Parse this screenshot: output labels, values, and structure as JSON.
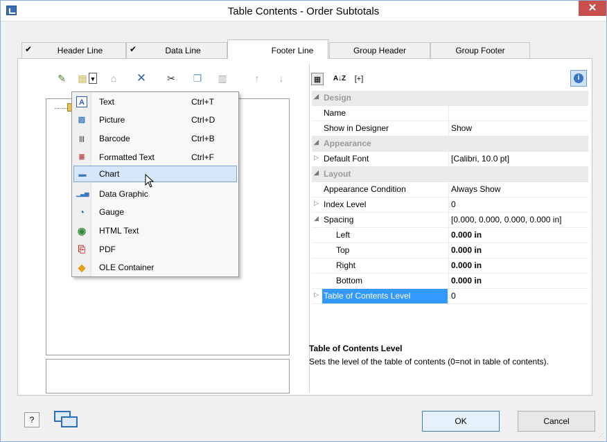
{
  "window": {
    "title": "Table Contents - Order Subtotals",
    "close_glyph": "✕"
  },
  "tabs": [
    {
      "label": "Header Line",
      "checked": true
    },
    {
      "label": "Data Line",
      "checked": true
    },
    {
      "label": "Footer Line",
      "checked": false,
      "active": true
    },
    {
      "label": "Group Header",
      "checked": false
    },
    {
      "label": "Group Footer",
      "checked": false
    }
  ],
  "check_glyph": "✔",
  "left_toolbar": {
    "icons": [
      "edit-object-icon",
      "insert-object-icon",
      "dropdown-arrow-icon",
      "properties-icon",
      "delete-icon",
      "cut-icon",
      "copy-icon",
      "paste-icon",
      "move-up-icon",
      "move-down-icon"
    ]
  },
  "insert_menu": {
    "items": [
      {
        "label": "Text",
        "shortcut": "Ctrl+T",
        "icon": "text-object-icon",
        "glyph": "A"
      },
      {
        "label": "Picture",
        "shortcut": "Ctrl+D",
        "icon": "picture-object-icon",
        "glyph": "▨"
      },
      {
        "label": "Barcode",
        "shortcut": "Ctrl+B",
        "icon": "barcode-object-icon",
        "glyph": "|||"
      },
      {
        "label": "Formatted Text",
        "shortcut": "Ctrl+F",
        "icon": "formatted-text-icon",
        "glyph": "≣"
      },
      {
        "label": "Chart",
        "shortcut": "",
        "icon": "chart-object-icon",
        "glyph": "▬",
        "highlighted": true
      },
      {
        "label": "Data Graphic",
        "shortcut": "",
        "icon": "data-graphic-icon",
        "glyph": "▁▃▅"
      },
      {
        "label": "Gauge",
        "shortcut": "",
        "icon": "gauge-icon",
        "glyph": "◔"
      },
      {
        "label": "HTML Text",
        "shortcut": "",
        "icon": "html-text-icon",
        "glyph": "◉"
      },
      {
        "label": "PDF",
        "shortcut": "",
        "icon": "pdf-icon",
        "glyph": "⎘"
      },
      {
        "label": "OLE Container",
        "shortcut": "",
        "icon": "ole-container-icon",
        "glyph": "◆"
      }
    ]
  },
  "right_toolbar": {
    "categorized_icon": "categorized-view-icon",
    "sort_glyph": "A↓Z",
    "expand_label": "[+]"
  },
  "properties": [
    {
      "kind": "section",
      "name": "Design",
      "expander": "◢"
    },
    {
      "kind": "prop",
      "name": "Name",
      "value": ""
    },
    {
      "kind": "prop",
      "name": "Show in Designer",
      "value": "Show"
    },
    {
      "kind": "section",
      "name": "Appearance",
      "expander": "◢"
    },
    {
      "kind": "prop",
      "name": "Default Font",
      "value": "[Calibri, 10.0 pt]",
      "expander": "▷"
    },
    {
      "kind": "section",
      "name": "Layout",
      "expander": "◢"
    },
    {
      "kind": "prop",
      "name": "Appearance Condition",
      "value": "Always Show"
    },
    {
      "kind": "prop",
      "name": "Index Level",
      "value": "0",
      "expander": "▷"
    },
    {
      "kind": "prop",
      "name": "Spacing",
      "value": "[0.000, 0.000, 0.000, 0.000 in]",
      "expander": "◢"
    },
    {
      "kind": "sub",
      "name": "Left",
      "value": "0.000 in"
    },
    {
      "kind": "sub",
      "name": "Top",
      "value": "0.000 in"
    },
    {
      "kind": "sub",
      "name": "Right",
      "value": "0.000 in"
    },
    {
      "kind": "sub",
      "name": "Bottom",
      "value": "0.000 in"
    },
    {
      "kind": "prop",
      "name": "Table of Contents Level",
      "value": "0",
      "expander": "▷",
      "selected": true
    }
  ],
  "description": {
    "title": "Table of Contents Level",
    "text": "Sets the level of the table of contents (0=not in table of contents)."
  },
  "footer": {
    "help_glyph": "?",
    "ok_label": "OK",
    "cancel_label": "Cancel"
  },
  "colors": {
    "selection": "#3399ff",
    "menu_highlight": "#d5e7f8",
    "close": "#c7504c"
  }
}
